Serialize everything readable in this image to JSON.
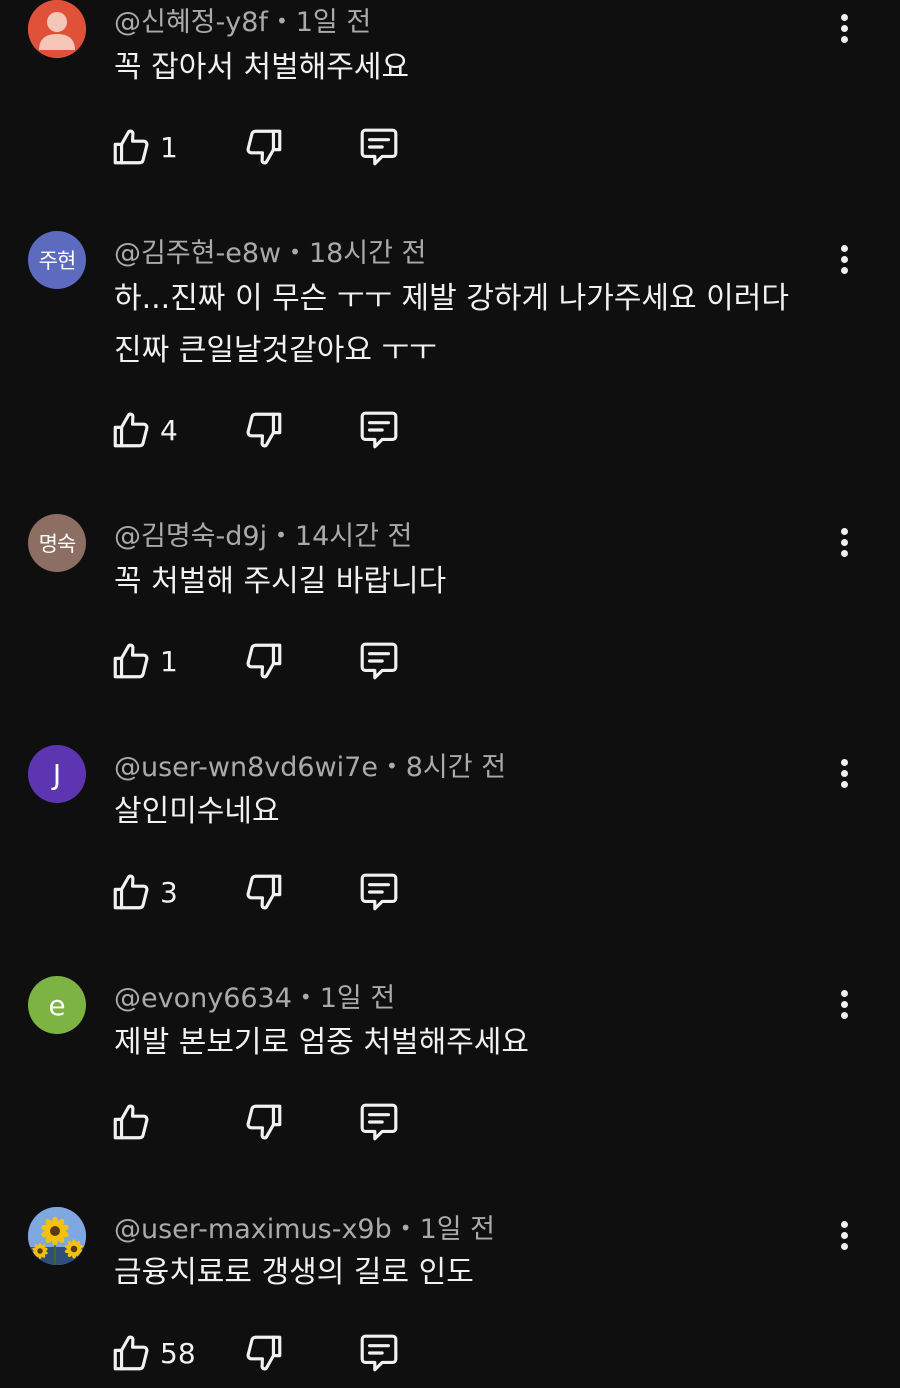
{
  "comments": [
    {
      "author": "@신혜정-y8f",
      "time": "1일 전",
      "text_lines": [
        "꼭 잡아서 처벌해주세요"
      ],
      "likes": "1",
      "avatar": {
        "kind": "default-person",
        "color": "#e0513a",
        "label": ""
      }
    },
    {
      "author": "@김주현-e8w",
      "time": "18시간 전",
      "text_lines": [
        "하...진짜  이 무슨 ㅜㅜ 제발 강하게 나가주세요  이러다",
        "진짜 큰일날것같아요 ㅜㅜ"
      ],
      "likes": "4",
      "avatar": {
        "kind": "text",
        "color": "#5c6bc0",
        "label": "주현"
      }
    },
    {
      "author": "@김명숙-d9j",
      "time": "14시간 전",
      "text_lines": [
        "꼭 처벌해 주시길 바랍니다"
      ],
      "likes": "1",
      "avatar": {
        "kind": "text",
        "color": "#8d6e63",
        "label": "명숙"
      }
    },
    {
      "author": "@user-wn8vd6wi7e",
      "time": "8시간 전",
      "text_lines": [
        "살인미수네요"
      ],
      "likes": "3",
      "avatar": {
        "kind": "text",
        "color": "#5e35b1",
        "label": "J"
      }
    },
    {
      "author": "@evony6634",
      "time": "1일 전",
      "text_lines": [
        "제발 본보기로 엄중 처벌해주세요"
      ],
      "likes": "",
      "avatar": {
        "kind": "text",
        "color": "#7cb342",
        "label": "e"
      }
    },
    {
      "author": "@user-maximus-x9b",
      "time": "1일 전",
      "text_lines": [
        "금융치료로 갱생의 길로 인도"
      ],
      "likes": "58",
      "avatar": {
        "kind": "sunflower-photo",
        "color": "#7fa7e0",
        "label": ""
      }
    }
  ],
  "icons": {
    "like": "thumb-up-icon",
    "dislike": "thumb-down-icon",
    "reply": "reply-comment-icon",
    "more": "more-vertical-icon"
  },
  "colors": {
    "background": "#0f0f0f",
    "text": "#f1f1f1",
    "meta": "#aaaaaa"
  }
}
